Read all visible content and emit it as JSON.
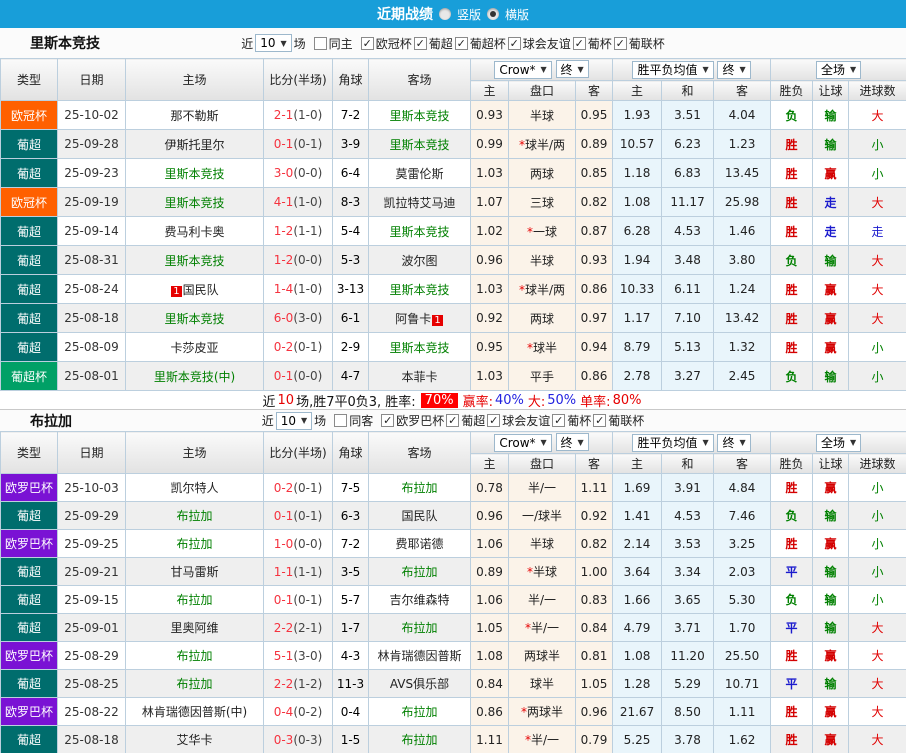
{
  "topbar": {
    "title": "近期战绩",
    "radio_vertical": "竖版",
    "radio_horizontal": "横版",
    "vertical_checked": false,
    "horizontal_checked": true
  },
  "colors": {
    "topbar_bg": "#189ed9",
    "leagues": {
      "欧冠杯": "#ff6000",
      "葡超": "#006d6d",
      "葡超杯": "#00a066",
      "欧罗巴杯": "#7a12d4"
    },
    "team_link": "#008000",
    "score": "#f5333f",
    "results": {
      "胜": "#d40000",
      "负": "#008000",
      "平": "#1a1acd",
      "赢": "#d40000",
      "输": "#008000",
      "走": "#1a1acd",
      "大": "#e00000",
      "小": "#008000"
    },
    "rate_badge_bg": "#ff0000"
  },
  "columns": [
    "类型",
    "日期",
    "主场",
    "比分(半场)",
    "角球",
    "客场"
  ],
  "sub_columns": [
    "主",
    "盘口",
    "客",
    "主",
    "和",
    "客",
    "胜负",
    "让球",
    "进球数"
  ],
  "dropdowns": {
    "crow": "Crow*",
    "final1": "终",
    "avg": "胜平负均值",
    "final2": "终",
    "fullmatch": "全场"
  },
  "filter_labels": {
    "near": "近",
    "count": "10",
    "match": "场"
  },
  "sections": [
    {
      "team": "里斯本竞技",
      "same_label": "同主",
      "same_checked": false,
      "leagues": [
        "欧冠杯",
        "葡超",
        "葡超杯",
        "球会友谊",
        "葡杯",
        "葡联杯"
      ],
      "rows": [
        {
          "lg": "欧冠杯",
          "date": "25-10-02",
          "home": "那不勒斯",
          "hg": false,
          "hc": "",
          "score": "2-1",
          "half": "1-0",
          "corner": "7-2",
          "away": "里斯本竞技",
          "ag": true,
          "ac": "",
          "o1": "0.93",
          "hcap": "半球",
          "o2": "0.95",
          "w": "1.93",
          "d": "3.51",
          "l": "4.04",
          "r1": "负",
          "r2": "输",
          "r3": "大"
        },
        {
          "lg": "葡超",
          "date": "25-09-28",
          "home": "伊斯托里尔",
          "hg": false,
          "hc": "",
          "score": "0-1",
          "half": "0-1",
          "corner": "3-9",
          "away": "里斯本竞技",
          "ag": true,
          "ac": "",
          "o1": "0.99",
          "hcap": "*球半/两",
          "o2": "0.89",
          "w": "10.57",
          "d": "6.23",
          "l": "1.23",
          "r1": "胜",
          "r2": "输",
          "r3": "小"
        },
        {
          "lg": "葡超",
          "date": "25-09-23",
          "home": "里斯本竞技",
          "hg": true,
          "hc": "",
          "score": "3-0",
          "half": "0-0",
          "corner": "6-4",
          "away": "莫雷伦斯",
          "ag": false,
          "ac": "",
          "o1": "1.03",
          "hcap": "两球",
          "o2": "0.85",
          "w": "1.18",
          "d": "6.83",
          "l": "13.45",
          "r1": "胜",
          "r2": "赢",
          "r3": "小"
        },
        {
          "lg": "欧冠杯",
          "date": "25-09-19",
          "home": "里斯本竞技",
          "hg": true,
          "hc": "",
          "score": "4-1",
          "half": "1-0",
          "corner": "8-3",
          "away": "凯拉特艾马迪",
          "ag": false,
          "ac": "",
          "o1": "1.07",
          "hcap": "三球",
          "o2": "0.82",
          "w": "1.08",
          "d": "11.17",
          "l": "25.98",
          "r1": "胜",
          "r2": "走",
          "r3": "大"
        },
        {
          "lg": "葡超",
          "date": "25-09-14",
          "home": "费马利卡奥",
          "hg": false,
          "hc": "",
          "score": "1-2",
          "half": "1-1",
          "corner": "5-4",
          "away": "里斯本竞技",
          "ag": true,
          "ac": "",
          "o1": "1.02",
          "hcap": "*一球",
          "o2": "0.87",
          "w": "6.28",
          "d": "4.53",
          "l": "1.46",
          "r1": "胜",
          "r2": "走",
          "r3": "走"
        },
        {
          "lg": "葡超",
          "date": "25-08-31",
          "home": "里斯本竞技",
          "hg": true,
          "hc": "",
          "score": "1-2",
          "half": "0-0",
          "corner": "5-3",
          "away": "波尔图",
          "ag": false,
          "ac": "",
          "o1": "0.96",
          "hcap": "半球",
          "o2": "0.93",
          "w": "1.94",
          "d": "3.48",
          "l": "3.80",
          "r1": "负",
          "r2": "输",
          "r3": "大"
        },
        {
          "lg": "葡超",
          "date": "25-08-24",
          "home": "国民队",
          "hg": false,
          "hc": "1",
          "score": "1-4",
          "half": "1-0",
          "corner": "3-13",
          "away": "里斯本竞技",
          "ag": true,
          "ac": "",
          "o1": "1.03",
          "hcap": "*球半/两",
          "o2": "0.86",
          "w": "10.33",
          "d": "6.11",
          "l": "1.24",
          "r1": "胜",
          "r2": "赢",
          "r3": "大"
        },
        {
          "lg": "葡超",
          "date": "25-08-18",
          "home": "里斯本竞技",
          "hg": true,
          "hc": "",
          "score": "6-0",
          "half": "3-0",
          "corner": "6-1",
          "away": "阿鲁卡",
          "ag": false,
          "ac": "1",
          "o1": "0.92",
          "hcap": "两球",
          "o2": "0.97",
          "w": "1.17",
          "d": "7.10",
          "l": "13.42",
          "r1": "胜",
          "r2": "赢",
          "r3": "大"
        },
        {
          "lg": "葡超",
          "date": "25-08-09",
          "home": "卡莎皮亚",
          "hg": false,
          "hc": "",
          "score": "0-2",
          "half": "0-1",
          "corner": "2-9",
          "away": "里斯本竞技",
          "ag": true,
          "ac": "",
          "o1": "0.95",
          "hcap": "*球半",
          "o2": "0.94",
          "w": "8.79",
          "d": "5.13",
          "l": "1.32",
          "r1": "胜",
          "r2": "赢",
          "r3": "小"
        },
        {
          "lg": "葡超杯",
          "date": "25-08-01",
          "home": "里斯本竞技(中)",
          "hg": true,
          "hc": "",
          "score": "0-1",
          "half": "0-0",
          "corner": "4-7",
          "away": "本菲卡",
          "ag": false,
          "ac": "",
          "o1": "1.03",
          "hcap": "平手",
          "o2": "0.86",
          "w": "2.78",
          "d": "3.27",
          "l": "2.45",
          "r1": "负",
          "r2": "输",
          "r3": "小"
        }
      ],
      "summary": {
        "near": "近",
        "count": "10",
        "rest": "场,胜7平0负3, 胜率:",
        "rate": "70%",
        "items": [
          {
            "label": "赢率:",
            "value": "40%",
            "color": "blue"
          },
          {
            "label": "大:",
            "value": "50%",
            "color": "blue"
          },
          {
            "label": "单率:",
            "value": "80%",
            "color": "red"
          }
        ]
      }
    },
    {
      "team": "布拉加",
      "same_label": "同客",
      "same_checked": false,
      "leagues": [
        "欧罗巴杯",
        "葡超",
        "球会友谊",
        "葡杯",
        "葡联杯"
      ],
      "rows": [
        {
          "lg": "欧罗巴杯",
          "date": "25-10-03",
          "home": "凯尔特人",
          "hg": false,
          "hc": "",
          "score": "0-2",
          "half": "0-1",
          "corner": "7-5",
          "away": "布拉加",
          "ag": true,
          "ac": "",
          "o1": "0.78",
          "hcap": "半/一",
          "o2": "1.11",
          "w": "1.69",
          "d": "3.91",
          "l": "4.84",
          "r1": "胜",
          "r2": "赢",
          "r3": "小"
        },
        {
          "lg": "葡超",
          "date": "25-09-29",
          "home": "布拉加",
          "hg": true,
          "hc": "",
          "score": "0-1",
          "half": "0-1",
          "corner": "6-3",
          "away": "国民队",
          "ag": false,
          "ac": "",
          "o1": "0.96",
          "hcap": "一/球半",
          "o2": "0.92",
          "w": "1.41",
          "d": "4.53",
          "l": "7.46",
          "r1": "负",
          "r2": "输",
          "r3": "小"
        },
        {
          "lg": "欧罗巴杯",
          "date": "25-09-25",
          "home": "布拉加",
          "hg": true,
          "hc": "",
          "score": "1-0",
          "half": "0-0",
          "corner": "7-2",
          "away": "费耶诺德",
          "ag": false,
          "ac": "",
          "o1": "1.06",
          "hcap": "半球",
          "o2": "0.82",
          "w": "2.14",
          "d": "3.53",
          "l": "3.25",
          "r1": "胜",
          "r2": "赢",
          "r3": "小"
        },
        {
          "lg": "葡超",
          "date": "25-09-21",
          "home": "甘马雷斯",
          "hg": false,
          "hc": "",
          "score": "1-1",
          "half": "1-1",
          "corner": "3-5",
          "away": "布拉加",
          "ag": true,
          "ac": "",
          "o1": "0.89",
          "hcap": "*半球",
          "o2": "1.00",
          "w": "3.64",
          "d": "3.34",
          "l": "2.03",
          "r1": "平",
          "r2": "输",
          "r3": "小"
        },
        {
          "lg": "葡超",
          "date": "25-09-15",
          "home": "布拉加",
          "hg": true,
          "hc": "",
          "score": "0-1",
          "half": "0-1",
          "corner": "5-7",
          "away": "吉尔维森特",
          "ag": false,
          "ac": "",
          "o1": "1.06",
          "hcap": "半/一",
          "o2": "0.83",
          "w": "1.66",
          "d": "3.65",
          "l": "5.30",
          "r1": "负",
          "r2": "输",
          "r3": "小"
        },
        {
          "lg": "葡超",
          "date": "25-09-01",
          "home": "里奥阿维",
          "hg": false,
          "hc": "",
          "score": "2-2",
          "half": "2-1",
          "corner": "1-7",
          "away": "布拉加",
          "ag": true,
          "ac": "",
          "o1": "1.05",
          "hcap": "*半/一",
          "o2": "0.84",
          "w": "4.79",
          "d": "3.71",
          "l": "1.70",
          "r1": "平",
          "r2": "输",
          "r3": "大"
        },
        {
          "lg": "欧罗巴杯",
          "date": "25-08-29",
          "home": "布拉加",
          "hg": true,
          "hc": "",
          "score": "5-1",
          "half": "3-0",
          "corner": "4-3",
          "away": "林肯瑞德因普斯",
          "ag": false,
          "ac": "",
          "o1": "1.08",
          "hcap": "两球半",
          "o2": "0.81",
          "w": "1.08",
          "d": "11.20",
          "l": "25.50",
          "r1": "胜",
          "r2": "赢",
          "r3": "大"
        },
        {
          "lg": "葡超",
          "date": "25-08-25",
          "home": "布拉加",
          "hg": true,
          "hc": "",
          "score": "2-2",
          "half": "1-2",
          "corner": "11-3",
          "away": "AVS俱乐部",
          "ag": false,
          "ac": "",
          "o1": "0.84",
          "hcap": "球半",
          "o2": "1.05",
          "w": "1.28",
          "d": "5.29",
          "l": "10.71",
          "r1": "平",
          "r2": "输",
          "r3": "大"
        },
        {
          "lg": "欧罗巴杯",
          "date": "25-08-22",
          "home": "林肯瑞德因普斯(中)",
          "hg": false,
          "hc": "",
          "score": "0-4",
          "half": "0-2",
          "corner": "0-4",
          "away": "布拉加",
          "ag": true,
          "ac": "",
          "o1": "0.86",
          "hcap": "*两球半",
          "o2": "0.96",
          "w": "21.67",
          "d": "8.50",
          "l": "1.11",
          "r1": "胜",
          "r2": "赢",
          "r3": "大"
        },
        {
          "lg": "葡超",
          "date": "25-08-18",
          "home": "艾华卡",
          "hg": false,
          "hc": "",
          "score": "0-3",
          "half": "0-3",
          "corner": "1-5",
          "away": "布拉加",
          "ag": true,
          "ac": "",
          "o1": "1.11",
          "hcap": "*半/一",
          "o2": "0.79",
          "w": "5.25",
          "d": "3.78",
          "l": "1.62",
          "r1": "胜",
          "r2": "赢",
          "r3": "大"
        }
      ],
      "summary": null
    }
  ]
}
